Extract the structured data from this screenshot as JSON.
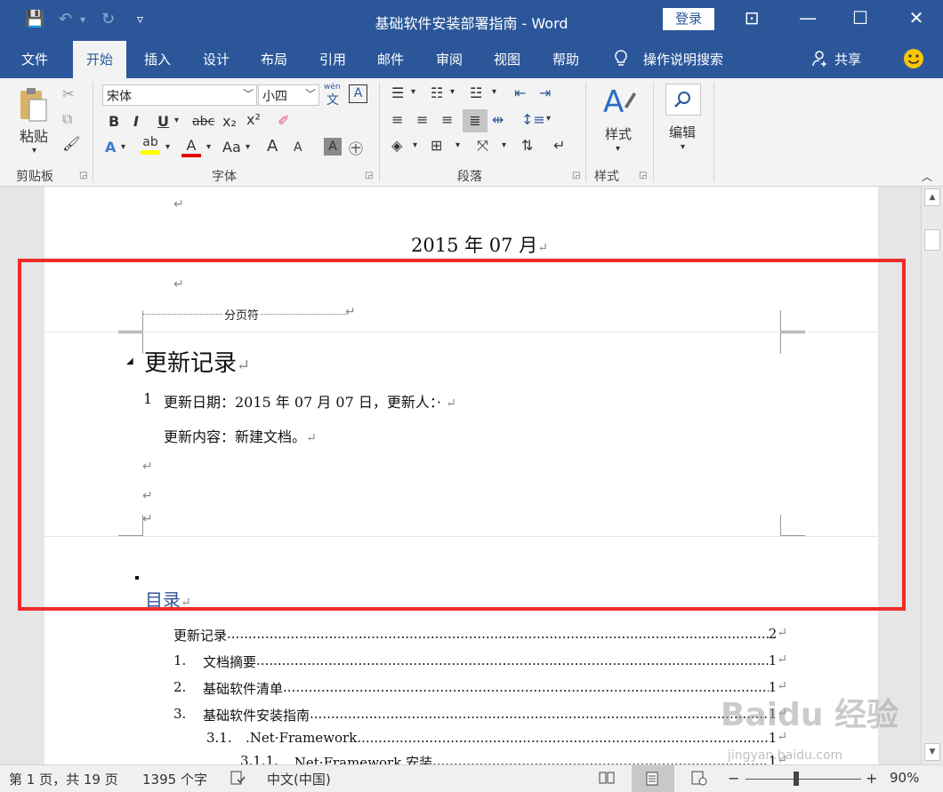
{
  "window": {
    "title": "基础软件安装部署指南 - Word",
    "login_label": "登录",
    "minimize": "—",
    "restore": "☐",
    "close": "✕",
    "ribbon_display": "⊡"
  },
  "quick_access": {
    "save": "💾",
    "undo": "↶",
    "undo_arrow": "▾",
    "redo": "↻",
    "customize": "▿"
  },
  "tabs": [
    {
      "label": "文件"
    },
    {
      "label": "开始"
    },
    {
      "label": "插入"
    },
    {
      "label": "设计"
    },
    {
      "label": "布局"
    },
    {
      "label": "引用"
    },
    {
      "label": "邮件"
    },
    {
      "label": "审阅"
    },
    {
      "label": "视图"
    },
    {
      "label": "帮助"
    }
  ],
  "tell_me": "操作说明搜索",
  "share": "共享",
  "ribbon": {
    "clipboard_label": "剪贴板",
    "paste_label": "粘贴",
    "font_label": "字体",
    "font_name": "宋体",
    "font_size": "小四",
    "paragraph_label": "段落",
    "styles_label": "样式",
    "styles_button": "样式",
    "edit_button": "编辑",
    "bold": "B",
    "italic": "I",
    "underline": "U",
    "strike": "abc",
    "sub": "x₂",
    "sup": "x²",
    "wen": "wén",
    "wen2": "文",
    "boxed_a": "A",
    "font_a": "A",
    "aa": "Aa",
    "grow": "A",
    "shrink": "A"
  },
  "document": {
    "return_mark": "↵",
    "date_line": "2015 年 07 月",
    "page_break": "分页符",
    "heading": "更新记录",
    "item_number": "1",
    "item_text": "更新日期：2015 年 07 月 07 日，更新人：·",
    "content_text": "更新内容：新建文档。",
    "toc_heading": "目录",
    "toc": [
      {
        "num": "",
        "text": "更新记录",
        "page": "2"
      },
      {
        "num": "1.",
        "text": "文档摘要",
        "page": "1"
      },
      {
        "num": "2.",
        "text": "基础软件清单",
        "page": "1"
      },
      {
        "num": "3.",
        "text": "基础软件安装指南",
        "page": "1"
      },
      {
        "num": "3.1.",
        "text": ".Net·Framework",
        "page": "1"
      },
      {
        "num": "3.1.1.",
        "text": ".Net·Framework 安装",
        "page": "1"
      }
    ]
  },
  "status": {
    "page": "第 1 页，共 19 页",
    "words": "1395 个字",
    "language": "中文(中国)",
    "zoom": "90%",
    "zoom_minus": "−",
    "zoom_plus": "+"
  },
  "watermark": {
    "main": "Baidu 经验",
    "sub": "jingyan.baidu.com"
  },
  "colors": {
    "accent": "#2b579a",
    "highlight_box": "#ee2b2b",
    "heading_blue": "#2f5496"
  }
}
